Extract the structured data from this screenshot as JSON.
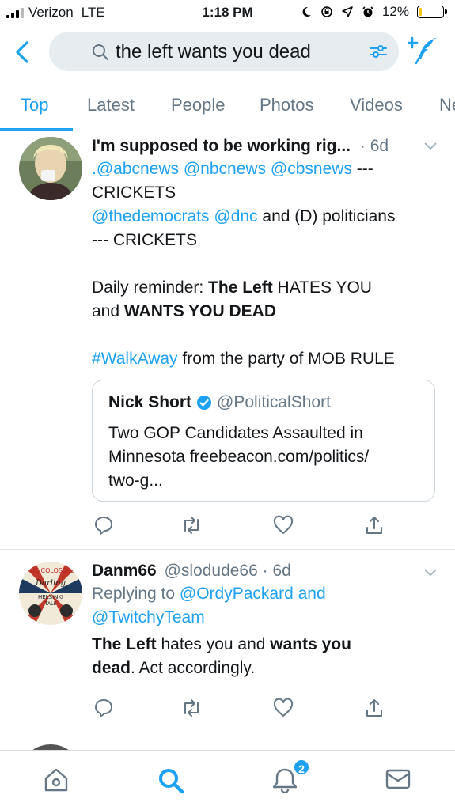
{
  "status_bar": {
    "carrier": "Verizon",
    "network": "LTE",
    "time": "1:18 PM",
    "battery": "12%",
    "battery_level": 0.12,
    "battery_color": "#f5c518"
  },
  "search": {
    "query": "the left wants you dead",
    "icons": [
      "back-chevron-icon",
      "search-icon",
      "filter-sliders-icon",
      "compose-tweet-icon"
    ]
  },
  "tabs": [
    "Top",
    "Latest",
    "People",
    "Photos",
    "Videos",
    "Ne"
  ],
  "accent_color": "#1da1f2",
  "tweets": [
    {
      "name": "I'm supposed to be working rig...",
      "time": "· 6d",
      "line1_link": ".@abcnews @nbcnews @cbsnews",
      "line1_rest": " ---",
      "line2": "CRICKETS",
      "line3_link": "@thedemocrats @dnc",
      "line3_rest": " and (D) politicians",
      "line4": "--- CRICKETS",
      "p2_a": "Daily reminder: ",
      "p2_b": "The Left",
      "p2_c": " HATES YOU",
      "p2_d": "and ",
      "p2_e": "WANTS YOU DEAD",
      "p3_link": "#WalkAway",
      "p3_rest": " from the party of MOB RULE",
      "quote": {
        "name": "Nick Short",
        "handle": "@PoliticalShort",
        "text_line1": "Two GOP Candidates Assaulted in",
        "text_line2": "Minnesota freebeacon.com/politics/",
        "text_line3": "two-g..."
      }
    },
    {
      "name": "Danm66",
      "handle": "@slodude66",
      "time": "· 6d",
      "replying_prefix": "Replying to ",
      "replying_to_1": "@OrdyPackard and",
      "replying_to_2": "@TwitchyTeam",
      "t1": "The Left",
      "t2": " hates you and ",
      "t3": "wants you",
      "t4": "dead",
      "t5": ". Act accordingly.",
      "avatar_text_1": "THE COLOSSUS",
      "avatar_text_2": "Darling",
      "avatar_text_3": "HELSINKI",
      "avatar_text_4": "TALE"
    }
  ],
  "bottom_nav": {
    "items": [
      "home-icon",
      "search-icon",
      "notifications-bell-icon",
      "messages-envelope-icon"
    ],
    "notification_count": "2"
  }
}
